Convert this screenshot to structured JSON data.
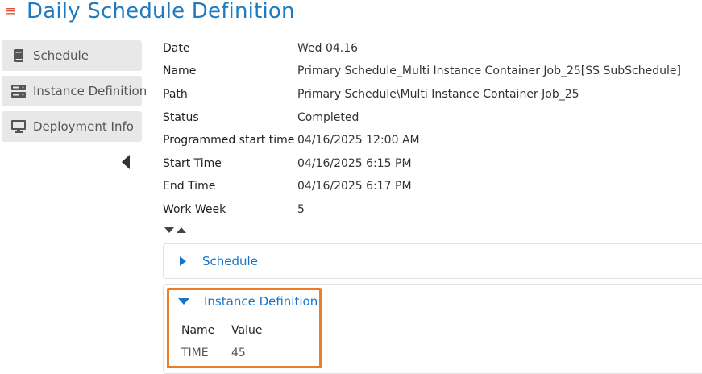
{
  "header": {
    "menu_icon": "hamburger-icon",
    "title": "Daily Schedule Definition"
  },
  "sidebar": {
    "items": [
      {
        "label": "Schedule",
        "icon": "book-icon"
      },
      {
        "label": "Instance Definition",
        "icon": "server-icon"
      },
      {
        "label": "Deployment Info",
        "icon": "monitor-icon"
      }
    ],
    "collapse_icon": "chevron-left-icon"
  },
  "properties": [
    {
      "key": "Date",
      "value": "Wed 04.16"
    },
    {
      "key": "Name",
      "value": "Primary Schedule_Multi Instance Container Job_25[SS SubSchedule]"
    },
    {
      "key": "Path",
      "value": "Primary Schedule\\Multi Instance Container Job_25"
    },
    {
      "key": "Status",
      "value": "Completed"
    },
    {
      "key": "Programmed start time",
      "value": "04/16/2025 12:00 AM"
    },
    {
      "key": "Start Time",
      "value": "04/16/2025 6:15 PM"
    },
    {
      "key": "End Time",
      "value": "04/16/2025 6:17 PM"
    },
    {
      "key": "Work Week",
      "value": "5"
    }
  ],
  "panels": {
    "schedule": {
      "title": "Schedule",
      "expanded": false
    },
    "instance_definition": {
      "title": "Instance Definition",
      "expanded": true,
      "columns": [
        "Name",
        "Value"
      ],
      "rows": [
        [
          "TIME",
          "45"
        ]
      ]
    }
  },
  "colors": {
    "title": "#1f7bc1",
    "link": "#1a73c9",
    "highlight": "#f07b26",
    "menu": "#e0533a"
  }
}
